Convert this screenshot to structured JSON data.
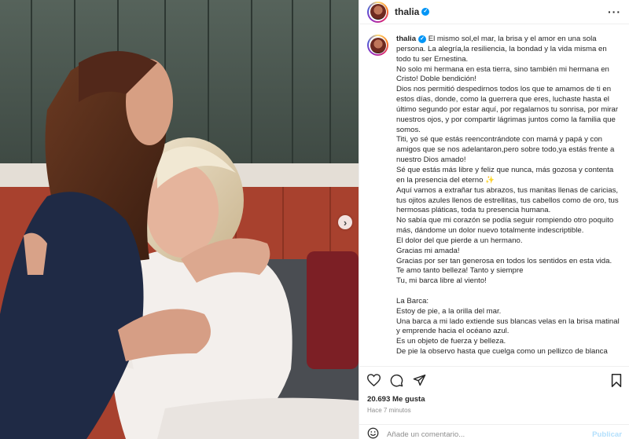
{
  "post": {
    "username": "thalia",
    "verified_icon": "verified-badge-icon",
    "more_icon": "more-options-icon",
    "next_arrow": "›"
  },
  "caption": {
    "username": "thalia",
    "text": "El mismo sol,el mar, la brisa y el amor en una sola persona. La alegría,la resiliencia, la bondad y la vida misma en todo tu ser Ernestina.\nNo solo mi hermana en esta tierra, sino también mi hermana en Cristo! Doble bendición!\nDios nos permitió despedirnos todos los que te amamos de ti en estos días, donde, como la guerrera que eres, luchaste hasta el último segundo por estar aquí, por regalarnos tu sonrisa, por mirar nuestros ojos, y por compartir lágrimas juntos como la familia que somos.\nTiti, yo sé que estás reencontrándote con mamá y papá y con amigos que se nos adelantaron,pero sobre todo,ya estás frente a nuestro Dios amado!\nSé que estás más libre y feliz que nunca, más gozosa y contenta en la presencia del eterno ✨\nAquí vamos a extrañar tus abrazos, tus manitas llenas de caricias, tus ojitos azules llenos de estrellitas, tus cabellos como de oro, tus hermosas pláticas, toda tu presencia humana.\nNo sabía que mi corazón se podía seguir rompiendo otro poquito más, dándome un dolor nuevo totalmente indescriptible.\nEl dolor del que pierde a un hermano.\nGracias mi amada!\nGracias por ser tan generosa en todos los sentidos en esta vida.\nTe amo tanto belleza! Tanto y siempre\nTu, mi barca libre al viento!\n\nLa Barca:\nEstoy de pie, a la orilla del mar.\nUna barca a mi lado extiende sus blancas velas en la brisa matinal y emprende hacia el océano azul.\nEs un objeto de fuerza y belleza.\nDe pie la observo hasta que cuelga como un pellizco de blanca"
  },
  "actions": {
    "like_icon": "heart-icon",
    "comment_icon": "comment-icon",
    "share_icon": "share-icon",
    "save_icon": "bookmark-icon",
    "likes": "20.693 Me gusta",
    "time": "Hace 7 minutos"
  },
  "comment": {
    "emoji_icon": "emoji-icon",
    "placeholder": "Añade un comentario...",
    "publish": "Publicar",
    "publish_color": "#b2dffc"
  },
  "colors": {
    "accent": "#0095f6",
    "text": "#262626",
    "muted": "#8e8e8e"
  }
}
